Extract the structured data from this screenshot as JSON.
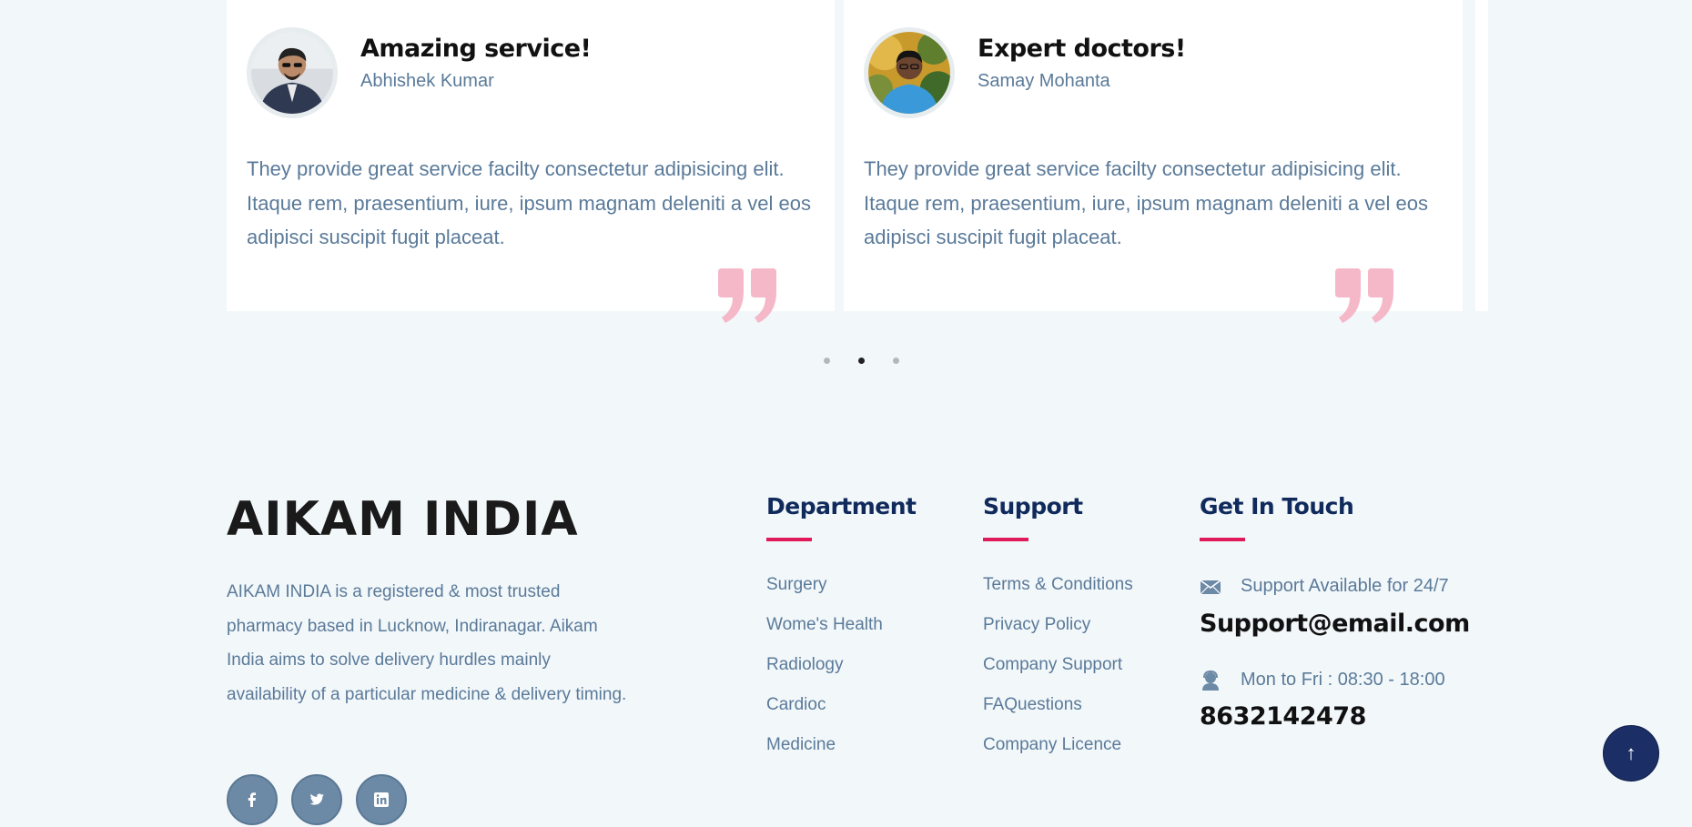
{
  "testimonials": [
    {
      "title": "Amazing service!",
      "name": "Abhishek Kumar",
      "text": "They provide great service facilty consectetur adipisicing elit. Itaque rem, praesentium, iure, ipsum magnam deleniti a vel eos adipisci suscipit fugit placeat."
    },
    {
      "title": "Expert doctors!",
      "name": "Samay Mohanta",
      "text": "They provide great service facilty consectetur adipisicing elit. Itaque rem, praesentium, iure, ipsum magnam deleniti a vel eos adipisci suscipit fugit placeat."
    }
  ],
  "carousel": {
    "page_count": 3,
    "active_index": 1
  },
  "footer": {
    "brand": "AIKAM INDIA",
    "about": "AIKAM INDIA is a registered & most trusted pharmacy based in Lucknow, Indiranagar. Aikam India aims to solve delivery hurdles mainly availability of a particular medicine & delivery timing.",
    "socials": [
      "facebook-icon",
      "twitter-icon",
      "linkedin-icon"
    ],
    "department": {
      "heading": "Department",
      "links": [
        "Surgery",
        "Wome's Health",
        "Radiology",
        "Cardioc",
        "Medicine"
      ]
    },
    "support": {
      "heading": "Support",
      "links": [
        "Terms & Conditions",
        "Privacy Policy",
        "Company Support",
        "FAQuestions",
        "Company Licence"
      ]
    },
    "touch": {
      "heading": "Get In Touch",
      "email_label": "Support Available for 24/7",
      "email": "Support@email.com",
      "hours_label": "Mon to Fri : 08:30 - 18:00",
      "phone": "8632142478"
    }
  },
  "back_to_top": {
    "label": "↑"
  },
  "colors": {
    "accent": "#e0195b",
    "heading": "#102a5c",
    "body_text": "#5a7a99",
    "social_bg": "#6c89a6",
    "quote": "#f5b8c8",
    "top_button": "#1b2f66"
  }
}
